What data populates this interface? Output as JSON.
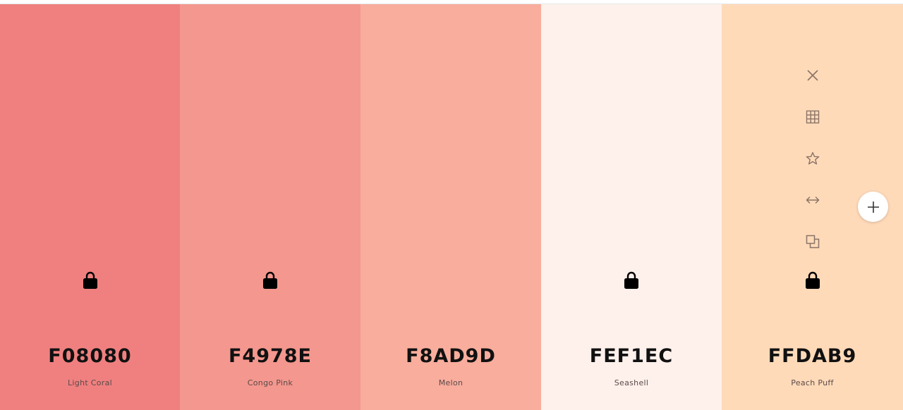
{
  "swatches": [
    {
      "hex": "F08080",
      "name": "Light Coral",
      "color": "#F08080",
      "locked": true,
      "show_tools": false
    },
    {
      "hex": "F4978E",
      "name": "Congo Pink",
      "color": "#F4978E",
      "locked": true,
      "show_tools": false
    },
    {
      "hex": "F8AD9D",
      "name": "Melon",
      "color": "#F8AD9D",
      "locked": false,
      "show_tools": false
    },
    {
      "hex": "FEF1EC",
      "name": "Seashell",
      "color": "#FEF1EC",
      "locked": true,
      "show_tools": false
    },
    {
      "hex": "FFDAB9",
      "name": "Peach Puff",
      "color": "#FFDAB9",
      "locked": true,
      "show_tools": true
    }
  ],
  "tool_icons": [
    "close-icon",
    "grid-icon",
    "star-icon",
    "drag-arrows-icon",
    "copy-icon"
  ],
  "add_button_icon": "plus-icon",
  "colors": {
    "icon_muted": "#8a7466",
    "lock": "#000000",
    "hex_text": "#111111",
    "name_text": "#5a4a48"
  }
}
